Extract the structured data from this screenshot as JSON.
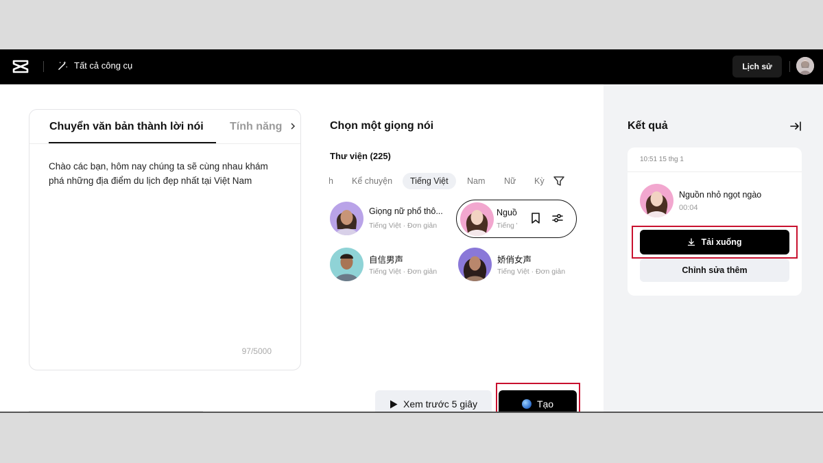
{
  "topbar": {
    "tools_label": "Tất cả công cụ",
    "history_label": "Lịch sử"
  },
  "editor": {
    "tabs": [
      {
        "label": "Chuyển văn bản thành lời nói",
        "active": true
      },
      {
        "label": "Tính năng",
        "active": false
      }
    ],
    "text": "Chào các bạn, hôm nay chúng ta sẽ cùng nhau khám phá những địa điểm du lịch đẹp nhất tại Việt Nam",
    "char_count": "97/5000"
  },
  "voice_picker": {
    "title": "Chọn một giọng nói",
    "library_label": "Thư viện (225)",
    "chips": [
      {
        "label": "h"
      },
      {
        "label": "Kể chuyện"
      },
      {
        "label": "Tiếng Việt",
        "active": true
      },
      {
        "label": "Nam"
      },
      {
        "label": "Nữ"
      },
      {
        "label": "Kỳ"
      }
    ],
    "voices": [
      {
        "name": "Giọng nữ phổ thô...",
        "meta": "Tiếng Việt · Đơn giản"
      },
      {
        "name": "Nguồn nhỏ ngọt ngào",
        "meta": "Tiếng Việt · Đơn giản",
        "selected": true
      },
      {
        "name": "自信男声",
        "meta": "Tiếng Việt · Đơn giản"
      },
      {
        "name": "娇俏女声",
        "meta": "Tiếng Việt · Đơn giản"
      }
    ]
  },
  "actions": {
    "preview_label": "Xem trước 5 giây",
    "create_label": "Tạo"
  },
  "results": {
    "title": "Kết quả",
    "timestamp": "10:51 15 thg 1",
    "voice_name": "Nguồn nhỏ ngọt ngào",
    "duration": "00:04",
    "download_label": "Tải xuống",
    "edit_label": "Chỉnh sửa thêm"
  },
  "colors": {
    "accent": "#000000",
    "highlight_box": "#c8102e",
    "results_bg": "#f2f3f5"
  }
}
